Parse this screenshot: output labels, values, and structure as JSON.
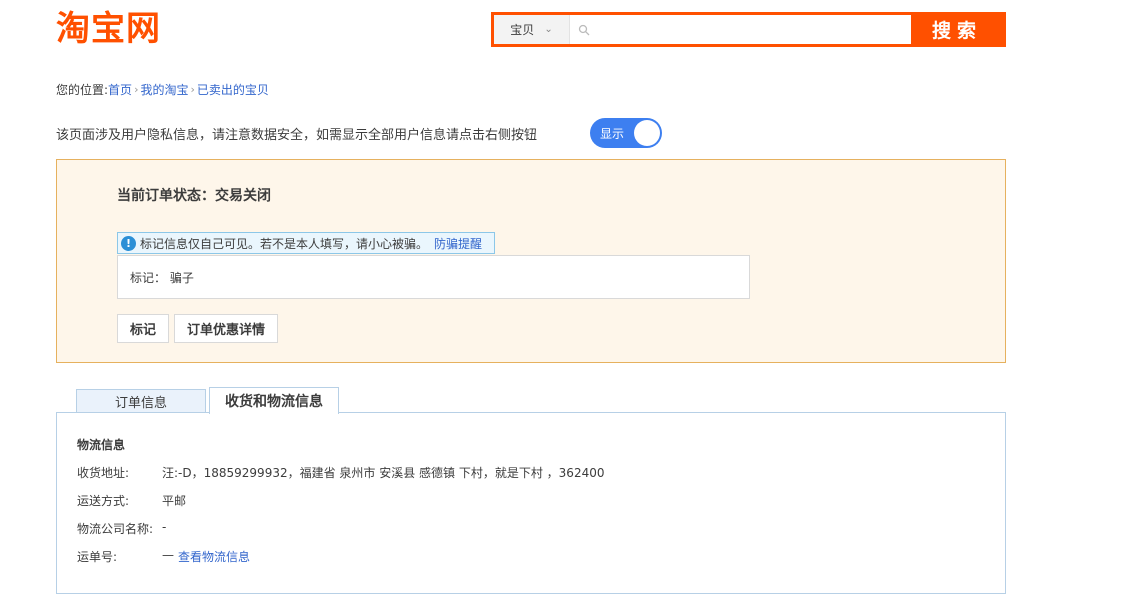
{
  "header": {
    "logo": "淘宝网",
    "search": {
      "category": "宝贝",
      "placeholder": "",
      "button": "搜索"
    }
  },
  "breadcrumb": {
    "prefix": "您的位置:",
    "items": [
      "首页",
      "我的淘宝",
      "已卖出的宝贝"
    ]
  },
  "privacy": {
    "text": "该页面涉及用户隐私信息，请注意数据安全，如需显示全部用户信息请点击右侧按钮",
    "toggle_label": "显示"
  },
  "order_status": {
    "title": "当前订单状态：交易关闭",
    "notice": "标记信息仅自己可见。若不是本人填写，请小心被骗。",
    "notice_link": "防骗提醒",
    "mark": "标记： 骗子",
    "buttons": [
      "标记",
      "订单优惠详情"
    ]
  },
  "tabs": [
    "订单信息",
    "收货和物流信息"
  ],
  "logistics": {
    "heading": "物流信息",
    "rows": [
      {
        "label": "收货地址:",
        "value": "汪:-D，18859299932，福建省 泉州市 安溪县 感德镇 下村，就是下村 ，362400"
      },
      {
        "label": "运送方式:",
        "value": "平邮"
      },
      {
        "label": "物流公司名称:",
        "value": "-"
      },
      {
        "label": "运单号:",
        "value": "—",
        "link": "查看物流信息"
      }
    ]
  },
  "colors": {
    "brand": "#ff5000",
    "link": "#3366cc",
    "toggle": "#3d7ff0",
    "status_bg": "#fef6ea",
    "status_border": "#e6b15e"
  }
}
